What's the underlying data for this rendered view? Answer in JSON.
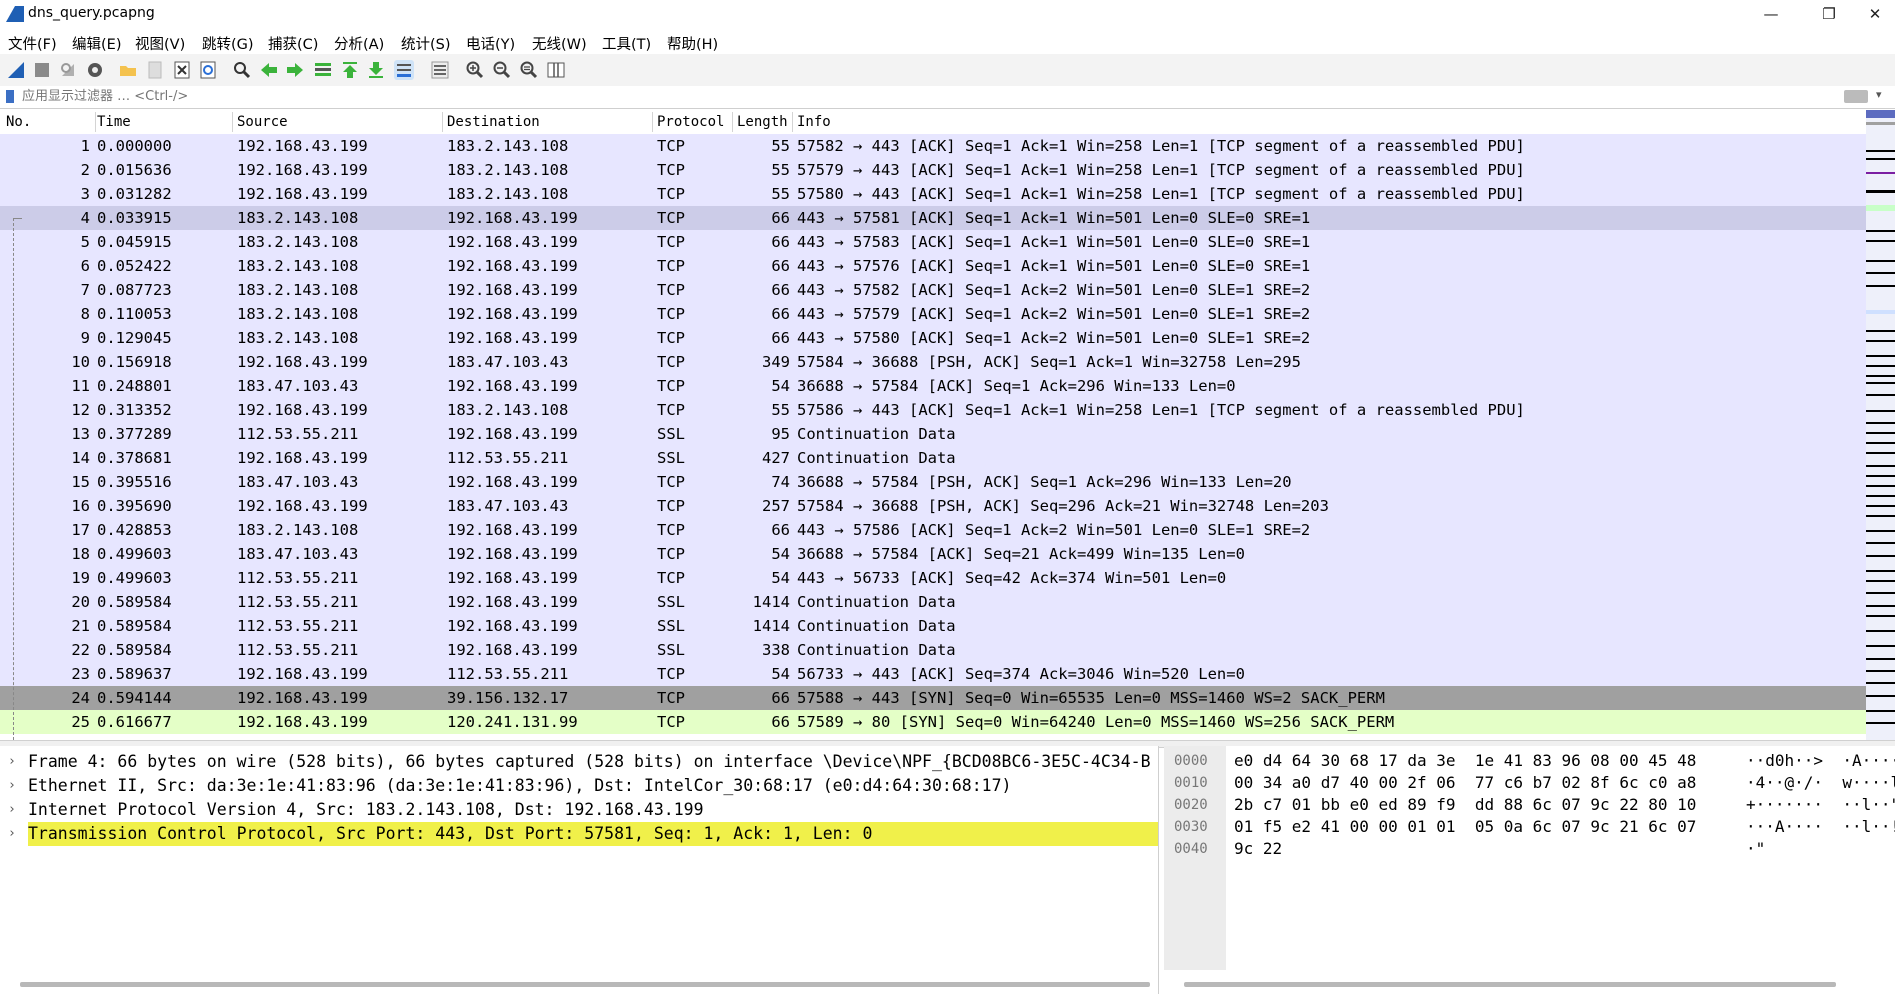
{
  "window": {
    "title": "dns_query.pcapng",
    "minimize_glyph": "—",
    "maximize_glyph": "❐",
    "close_glyph": "✕"
  },
  "menu": [
    "文件(F)",
    "编辑(E)",
    "视图(V)",
    "跳转(G)",
    "捕获(C)",
    "分析(A)",
    "统计(S)",
    "电话(Y)",
    "无线(W)",
    "工具(T)",
    "帮助(H)"
  ],
  "toolbar": {
    "icons": [
      "start-capture-icon",
      "stop-capture-icon",
      "restart-capture-icon",
      "capture-options-icon",
      "open-file-icon",
      "save-file-icon",
      "close-file-icon",
      "reload-file-icon",
      "find-packet-icon",
      "go-back-icon",
      "go-forward-icon",
      "go-to-packet-icon",
      "first-packet-icon",
      "last-packet-icon",
      "autoscroll-icon",
      "colorize-icon",
      "zoom-in-icon",
      "zoom-out-icon",
      "normal-size-icon",
      "resize-columns-icon"
    ]
  },
  "filter": {
    "placeholder": "应用显示过滤器 … <Ctrl-/>"
  },
  "columns": [
    "No.",
    "Time",
    "Source",
    "Destination",
    "Protocol",
    "Length",
    "Info"
  ],
  "colors": {
    "tcp_row": "#e7e6ff",
    "selected_row": "#cccce8",
    "dark_row": "#a0a0a0",
    "syn_row": "#e4ffc7",
    "highlight_detail": "#f0f04a"
  },
  "packets": [
    {
      "no": "1",
      "time": "0.000000",
      "src": "192.168.43.199",
      "dst": "183.2.143.108",
      "proto": "TCP",
      "len": "55",
      "info": "57582 → 443 [ACK] Seq=1 Ack=1 Win=258 Len=1 [TCP segment of a reassembled PDU]",
      "style": "tcp"
    },
    {
      "no": "2",
      "time": "0.015636",
      "src": "192.168.43.199",
      "dst": "183.2.143.108",
      "proto": "TCP",
      "len": "55",
      "info": "57579 → 443 [ACK] Seq=1 Ack=1 Win=258 Len=1 [TCP segment of a reassembled PDU]",
      "style": "tcp"
    },
    {
      "no": "3",
      "time": "0.031282",
      "src": "192.168.43.199",
      "dst": "183.2.143.108",
      "proto": "TCP",
      "len": "55",
      "info": "57580 → 443 [ACK] Seq=1 Ack=1 Win=258 Len=1 [TCP segment of a reassembled PDU]",
      "style": "tcp"
    },
    {
      "no": "4",
      "time": "0.033915",
      "src": "183.2.143.108",
      "dst": "192.168.43.199",
      "proto": "TCP",
      "len": "66",
      "info": "443 → 57581 [ACK] Seq=1 Ack=1 Win=501 Len=0 SLE=0 SRE=1",
      "style": "selected"
    },
    {
      "no": "5",
      "time": "0.045915",
      "src": "183.2.143.108",
      "dst": "192.168.43.199",
      "proto": "TCP",
      "len": "66",
      "info": "443 → 57583 [ACK] Seq=1 Ack=1 Win=501 Len=0 SLE=0 SRE=1",
      "style": "tcp"
    },
    {
      "no": "6",
      "time": "0.052422",
      "src": "183.2.143.108",
      "dst": "192.168.43.199",
      "proto": "TCP",
      "len": "66",
      "info": "443 → 57576 [ACK] Seq=1 Ack=1 Win=501 Len=0 SLE=0 SRE=1",
      "style": "tcp"
    },
    {
      "no": "7",
      "time": "0.087723",
      "src": "183.2.143.108",
      "dst": "192.168.43.199",
      "proto": "TCP",
      "len": "66",
      "info": "443 → 57582 [ACK] Seq=1 Ack=2 Win=501 Len=0 SLE=1 SRE=2",
      "style": "tcp"
    },
    {
      "no": "8",
      "time": "0.110053",
      "src": "183.2.143.108",
      "dst": "192.168.43.199",
      "proto": "TCP",
      "len": "66",
      "info": "443 → 57579 [ACK] Seq=1 Ack=2 Win=501 Len=0 SLE=1 SRE=2",
      "style": "tcp"
    },
    {
      "no": "9",
      "time": "0.129045",
      "src": "183.2.143.108",
      "dst": "192.168.43.199",
      "proto": "TCP",
      "len": "66",
      "info": "443 → 57580 [ACK] Seq=1 Ack=2 Win=501 Len=0 SLE=1 SRE=2",
      "style": "tcp"
    },
    {
      "no": "10",
      "time": "0.156918",
      "src": "192.168.43.199",
      "dst": "183.47.103.43",
      "proto": "TCP",
      "len": "349",
      "info": "57584 → 36688 [PSH, ACK] Seq=1 Ack=1 Win=32758 Len=295",
      "style": "tcp"
    },
    {
      "no": "11",
      "time": "0.248801",
      "src": "183.47.103.43",
      "dst": "192.168.43.199",
      "proto": "TCP",
      "len": "54",
      "info": "36688 → 57584 [ACK] Seq=1 Ack=296 Win=133 Len=0",
      "style": "tcp"
    },
    {
      "no": "12",
      "time": "0.313352",
      "src": "192.168.43.199",
      "dst": "183.2.143.108",
      "proto": "TCP",
      "len": "55",
      "info": "57586 → 443 [ACK] Seq=1 Ack=1 Win=258 Len=1 [TCP segment of a reassembled PDU]",
      "style": "tcp"
    },
    {
      "no": "13",
      "time": "0.377289",
      "src": "112.53.55.211",
      "dst": "192.168.43.199",
      "proto": "SSL",
      "len": "95",
      "info": "Continuation Data",
      "style": "tcp"
    },
    {
      "no": "14",
      "time": "0.378681",
      "src": "192.168.43.199",
      "dst": "112.53.55.211",
      "proto": "SSL",
      "len": "427",
      "info": "Continuation Data",
      "style": "tcp"
    },
    {
      "no": "15",
      "time": "0.395516",
      "src": "183.47.103.43",
      "dst": "192.168.43.199",
      "proto": "TCP",
      "len": "74",
      "info": "36688 → 57584 [PSH, ACK] Seq=1 Ack=296 Win=133 Len=20",
      "style": "tcp"
    },
    {
      "no": "16",
      "time": "0.395690",
      "src": "192.168.43.199",
      "dst": "183.47.103.43",
      "proto": "TCP",
      "len": "257",
      "info": "57584 → 36688 [PSH, ACK] Seq=296 Ack=21 Win=32748 Len=203",
      "style": "tcp"
    },
    {
      "no": "17",
      "time": "0.428853",
      "src": "183.2.143.108",
      "dst": "192.168.43.199",
      "proto": "TCP",
      "len": "66",
      "info": "443 → 57586 [ACK] Seq=1 Ack=2 Win=501 Len=0 SLE=1 SRE=2",
      "style": "tcp"
    },
    {
      "no": "18",
      "time": "0.499603",
      "src": "183.47.103.43",
      "dst": "192.168.43.199",
      "proto": "TCP",
      "len": "54",
      "info": "36688 → 57584 [ACK] Seq=21 Ack=499 Win=135 Len=0",
      "style": "tcp"
    },
    {
      "no": "19",
      "time": "0.499603",
      "src": "112.53.55.211",
      "dst": "192.168.43.199",
      "proto": "TCP",
      "len": "54",
      "info": "443 → 56733 [ACK] Seq=42 Ack=374 Win=501 Len=0",
      "style": "tcp"
    },
    {
      "no": "20",
      "time": "0.589584",
      "src": "112.53.55.211",
      "dst": "192.168.43.199",
      "proto": "SSL",
      "len": "1414",
      "info": "Continuation Data",
      "style": "tcp"
    },
    {
      "no": "21",
      "time": "0.589584",
      "src": "112.53.55.211",
      "dst": "192.168.43.199",
      "proto": "SSL",
      "len": "1414",
      "info": "Continuation Data",
      "style": "tcp"
    },
    {
      "no": "22",
      "time": "0.589584",
      "src": "112.53.55.211",
      "dst": "192.168.43.199",
      "proto": "SSL",
      "len": "338",
      "info": "Continuation Data",
      "style": "tcp"
    },
    {
      "no": "23",
      "time": "0.589637",
      "src": "192.168.43.199",
      "dst": "112.53.55.211",
      "proto": "TCP",
      "len": "54",
      "info": "56733 → 443 [ACK] Seq=374 Ack=3046 Win=520 Len=0",
      "style": "tcp"
    },
    {
      "no": "24",
      "time": "0.594144",
      "src": "192.168.43.199",
      "dst": "39.156.132.17",
      "proto": "TCP",
      "len": "66",
      "info": "57588 → 443 [SYN] Seq=0 Win=65535 Len=0 MSS=1460 WS=2 SACK_PERM",
      "style": "dark"
    },
    {
      "no": "25",
      "time": "0.616677",
      "src": "192.168.43.199",
      "dst": "120.241.131.99",
      "proto": "TCP",
      "len": "66",
      "info": "57589 → 80 [SYN] Seq=0 Win=64240 Len=0 MSS=1460 WS=256 SACK_PERM",
      "style": "syn"
    }
  ],
  "details": [
    {
      "arrow": "›",
      "text": "Frame 4: 66 bytes on wire (528 bits), 66 bytes captured (528 bits) on interface \\Device\\NPF_{BCD08BC6-3E5C-4C34-B",
      "highlight": false
    },
    {
      "arrow": "›",
      "text": "Ethernet II, Src: da:3e:1e:41:83:96 (da:3e:1e:41:83:96), Dst: IntelCor_30:68:17 (e0:d4:64:30:68:17)",
      "highlight": false
    },
    {
      "arrow": "›",
      "text": "Internet Protocol Version 4, Src: 183.2.143.108, Dst: 192.168.43.199",
      "highlight": false
    },
    {
      "arrow": "›",
      "text": "Transmission Control Protocol, Src Port: 443, Dst Port: 57581, Seq: 1, Ack: 1, Len: 0",
      "highlight": true
    }
  ],
  "bytes": [
    {
      "offset": "0000",
      "hex": "e0 d4 64 30 68 17 da 3e  1e 41 83 96 08 00 45 48",
      "ascii": "··d0h··>  ·A····"
    },
    {
      "offset": "0010",
      "hex": "00 34 a0 d7 40 00 2f 06  77 c6 b7 02 8f 6c c0 a8",
      "ascii": "·4··@·/·  w····l"
    },
    {
      "offset": "0020",
      "hex": "2b c7 01 bb e0 ed 89 f9  dd 88 6c 07 9c 22 80 10",
      "ascii": "+·······  ··l··\""
    },
    {
      "offset": "0030",
      "hex": "01 f5 e2 41 00 00 01 01  05 0a 6c 07 9c 21 6c 07",
      "ascii": "···A····  ··l··!"
    },
    {
      "offset": "0040",
      "hex": "9c 22",
      "ascii": "·\""
    }
  ]
}
